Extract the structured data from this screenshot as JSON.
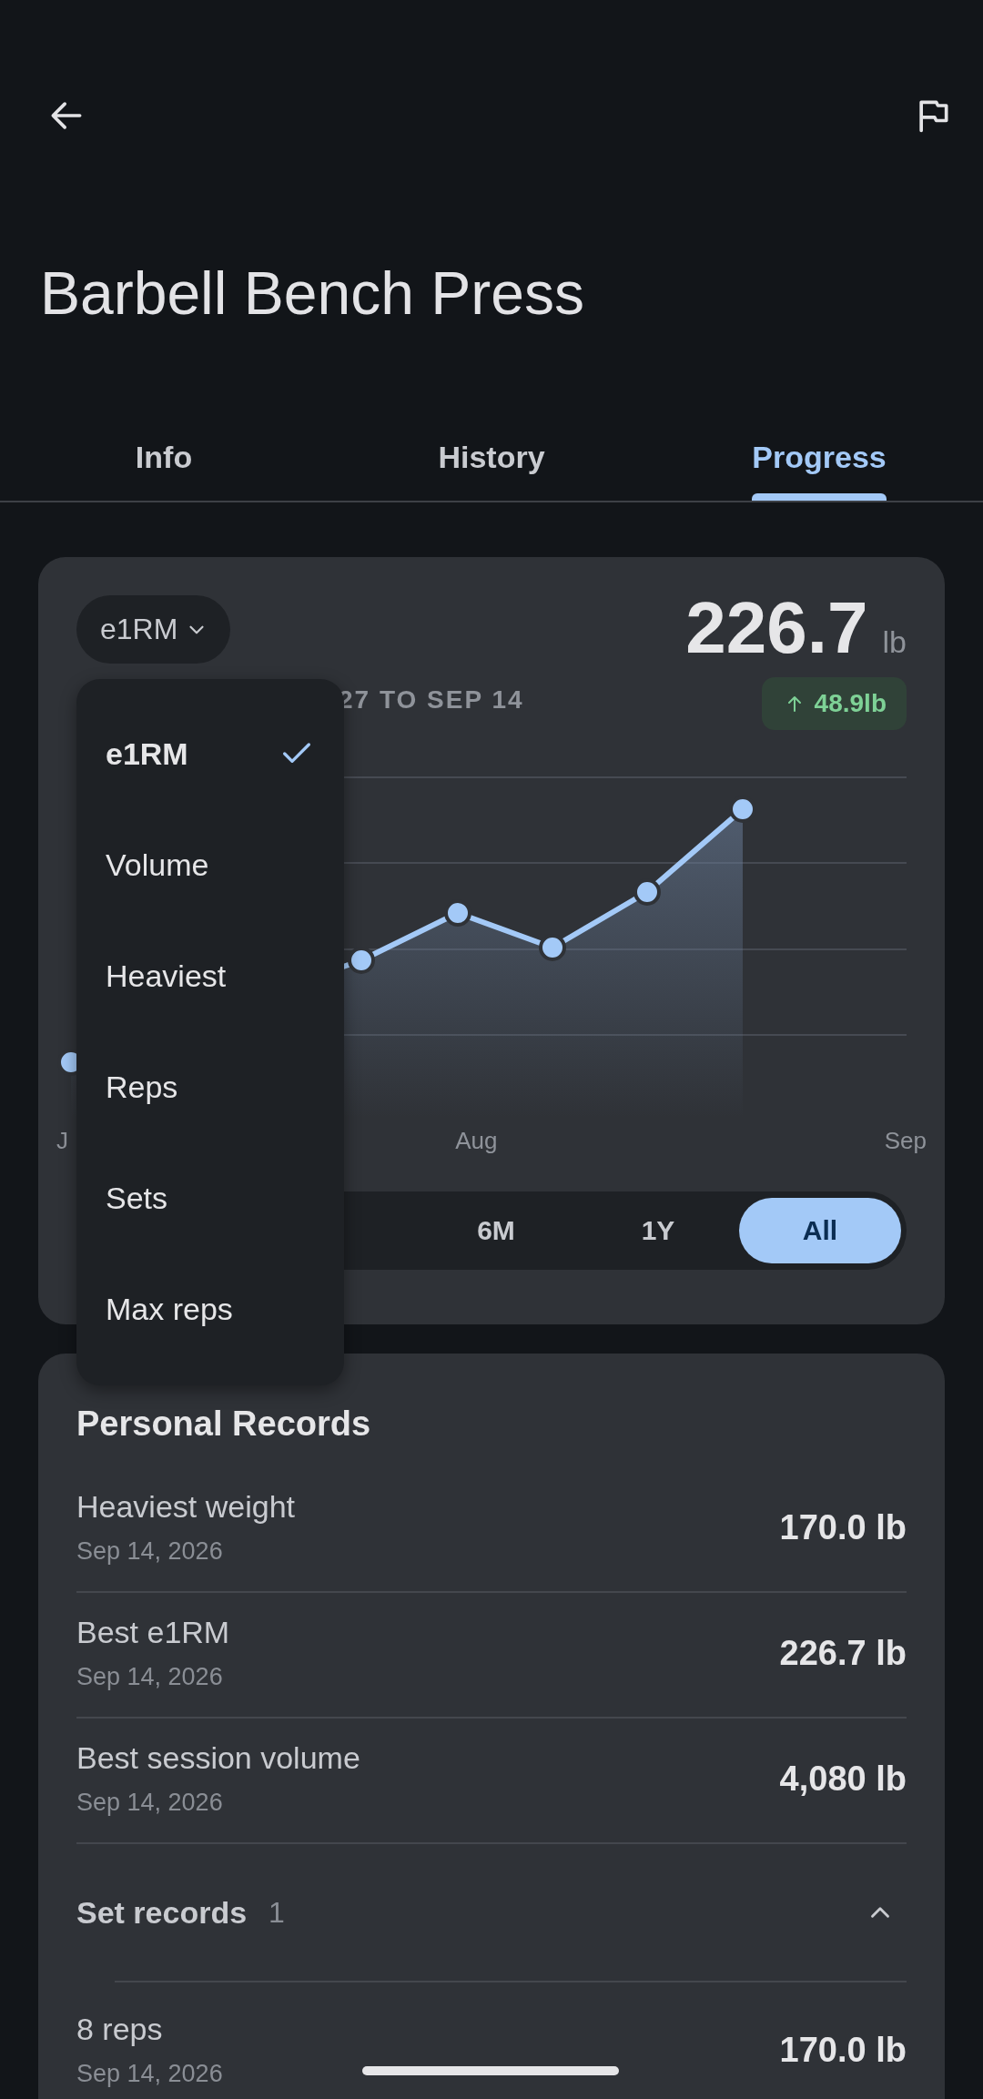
{
  "header": {
    "title": "Barbell Bench Press"
  },
  "tabs": [
    {
      "label": "Info",
      "selected": false
    },
    {
      "label": "History",
      "selected": false
    },
    {
      "label": "Progress",
      "selected": true
    }
  ],
  "progress_card": {
    "metric": "e1RM",
    "value": "226.7",
    "unit": "lb",
    "range": "27 TO SEP 14",
    "change": "48.9lb",
    "x_labels": [
      "J",
      "Aug",
      "Sep"
    ],
    "periods": [
      {
        "label": "6M",
        "selected": false
      },
      {
        "label": "1Y",
        "selected": false
      },
      {
        "label": "All",
        "selected": true
      }
    ]
  },
  "metric_menu": [
    {
      "label": "e1RM",
      "selected": true
    },
    {
      "label": "Volume",
      "selected": false
    },
    {
      "label": "Heaviest",
      "selected": false
    },
    {
      "label": "Reps",
      "selected": false
    },
    {
      "label": "Sets",
      "selected": false
    },
    {
      "label": "Max reps",
      "selected": false
    }
  ],
  "records": {
    "title": "Personal Records",
    "items": [
      {
        "label": "Heaviest weight",
        "date": "Sep 14, 2026",
        "value": "170.0 lb"
      },
      {
        "label": "Best e1RM",
        "date": "Sep 14, 2026",
        "value": "226.7 lb"
      },
      {
        "label": "Best session volume",
        "date": "Sep 14, 2026",
        "value": "4,080 lb"
      }
    ],
    "set_records": {
      "label": "Set records",
      "count": "1",
      "expanded": true,
      "items": [
        {
          "label": "8 reps",
          "date": "Sep 14, 2026",
          "value": "170.0 lb"
        }
      ]
    }
  }
}
